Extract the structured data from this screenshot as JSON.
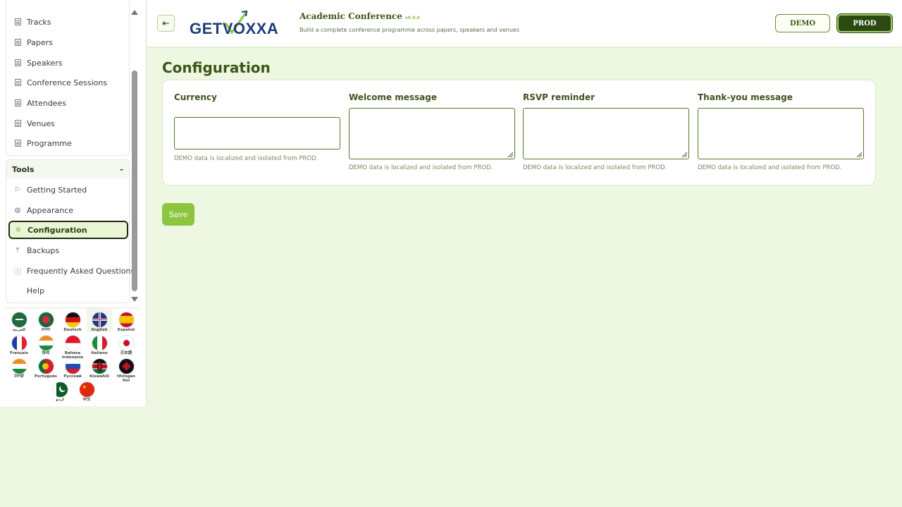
{
  "sidebar": {
    "nav_items": [
      {
        "label": "Tracks"
      },
      {
        "label": "Papers"
      },
      {
        "label": "Speakers"
      },
      {
        "label": "Conference Sessions"
      },
      {
        "label": "Attendees"
      },
      {
        "label": "Venues"
      },
      {
        "label": "Programme"
      }
    ],
    "tools": {
      "title": "Tools",
      "collapse_symbol": "-",
      "items": [
        {
          "label": "Getting Started",
          "icon": "flag-icon"
        },
        {
          "label": "Appearance",
          "icon": "palette-icon"
        },
        {
          "label": "Configuration",
          "icon": "gear-icon",
          "active": true
        },
        {
          "label": "Backups",
          "icon": "upload-icon"
        },
        {
          "label": "Frequently Asked Questions",
          "icon": "help-circle-icon"
        },
        {
          "label": "Help",
          "icon": ""
        }
      ]
    },
    "languages": [
      {
        "label": "العربية",
        "flag": "saudi-arabia"
      },
      {
        "label": "বাংলা",
        "flag": "bangladesh"
      },
      {
        "label": "Deutsch",
        "flag": "germany"
      },
      {
        "label": "English",
        "flag": "uk",
        "selected": true
      },
      {
        "label": "Español",
        "flag": "spain"
      },
      {
        "label": "Français",
        "flag": "france"
      },
      {
        "label": "हिन्दी",
        "flag": "india"
      },
      {
        "label": "Bahasa Indonesia",
        "flag": "indonesia"
      },
      {
        "label": "Italiano",
        "flag": "italy"
      },
      {
        "label": "日本語",
        "flag": "japan"
      },
      {
        "label": "ਪੰਜਾਬੀ",
        "flag": "india"
      },
      {
        "label": "Português",
        "flag": "portugal"
      },
      {
        "label": "Русский",
        "flag": "russia"
      },
      {
        "label": "Kiswahili",
        "flag": "kenya"
      },
      {
        "label": "tlhIngan Hol",
        "flag": "klingon"
      },
      {
        "label": "اردو",
        "flag": "pakistan"
      },
      {
        "label": "中文",
        "flag": "china"
      }
    ]
  },
  "header": {
    "menu_icon": "menu-collapse-icon",
    "logo_text": "GETVOXXA",
    "app_title": "Academic Conference",
    "app_version": "v9.0.0",
    "app_subtitle": "Build a complete conference programme across papers, speakers and venues",
    "demo_label": "DEMO",
    "prod_label": "PROD"
  },
  "main": {
    "page_title": "Configuration",
    "fields": [
      {
        "label": "Currency",
        "value": "",
        "hint": "DEMO data is localized and isolated from PROD."
      },
      {
        "label": "Welcome message",
        "value": "",
        "hint": "DEMO data is localized and isolated from PROD."
      },
      {
        "label": "RSVP reminder",
        "value": "",
        "hint": "DEMO data is localized and isolated from PROD."
      },
      {
        "label": "Thank-you message",
        "value": "",
        "hint": "DEMO data is localized and isolated from PROD."
      }
    ],
    "save_label": "Save"
  },
  "colors": {
    "accent": "#8cc63f",
    "primary_dark": "#2b4a11",
    "title_green": "#3a5713",
    "page_bg": "#eef7e2"
  }
}
